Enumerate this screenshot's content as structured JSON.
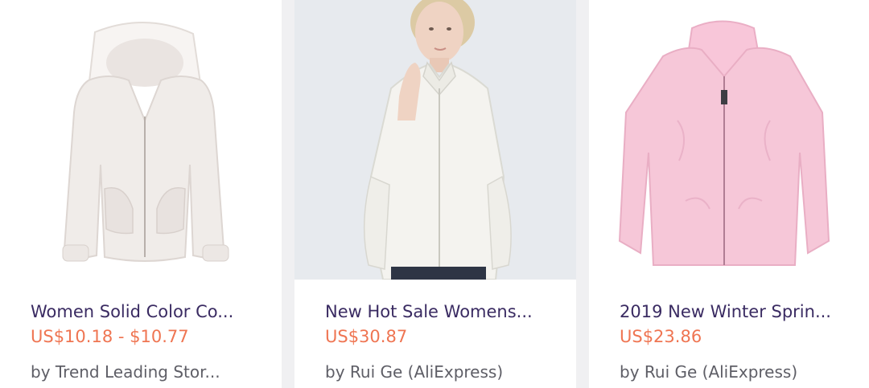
{
  "products": [
    {
      "title": "Women Solid Color Co...",
      "price": "US$10.18 - $10.77",
      "seller": "by Trend Leading Stor...",
      "image_alt": "white hooded fleece jacket",
      "color": "#f2efee"
    },
    {
      "title": "New Hot Sale Womens...",
      "price": "US$30.87",
      "seller": "by Rui Ge (AliExpress)",
      "image_alt": "model wearing white fleece jacket",
      "color": "#f4f3ef"
    },
    {
      "title": "2019 New Winter Sprin...",
      "price": "US$23.86",
      "seller": "by Rui Ge (AliExpress)",
      "image_alt": "pink fleece zip jacket",
      "color": "#f6c7d8"
    }
  ],
  "colors": {
    "title": "#3a2b62",
    "price": "#ef7552",
    "seller": "#5e5e66",
    "background": "#f0f0f2"
  }
}
